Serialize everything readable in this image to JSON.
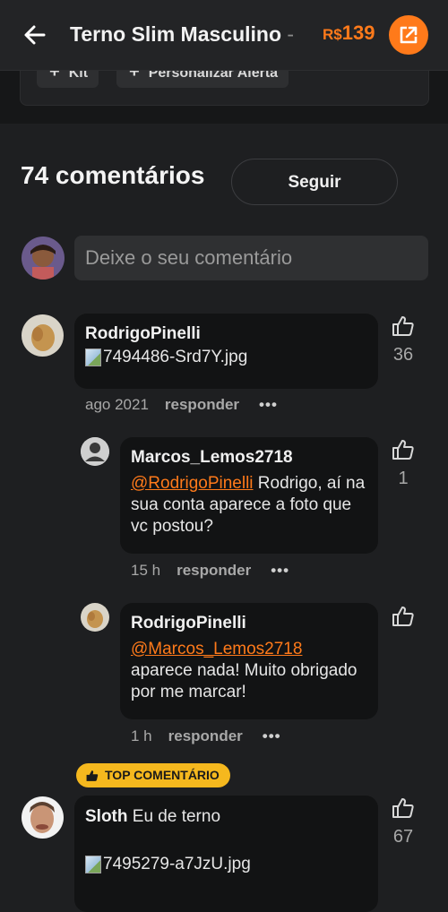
{
  "header": {
    "title": "Terno Slim Masculino",
    "title_suffix": "-",
    "price_currency": "R$",
    "price_value": "139"
  },
  "top_card": {
    "chips": [
      "Kit",
      "Personalizar Alerta"
    ]
  },
  "comments_section": {
    "title": "74 comentários",
    "follow_label": "Seguir",
    "input_placeholder": "Deixe o seu comentário"
  },
  "comments": [
    {
      "author": "RodrigoPinelli",
      "image_name": "7494486-Srd7Y.jpg",
      "date": "ago 2021",
      "reply_label": "responder",
      "more": "•••",
      "likes": "36"
    },
    {
      "author": "Marcos_Lemos2718",
      "mention": "@RodrigoPinelli",
      "text": " Rodrigo, aí na sua conta aparece a foto que vc postou?",
      "date": "15 h",
      "reply_label": "responder",
      "more": "•••",
      "likes": "1"
    },
    {
      "author": "RodrigoPinelli",
      "mention": "@Marcos_Lemos2718",
      "text": "aparece nada! Muito obrigado por me marcar!",
      "date": "1 h",
      "reply_label": "responder",
      "more": "•••",
      "likes": ""
    },
    {
      "badge": "TOP COMENTÁRIO",
      "author": "Sloth",
      "text": "Eu de terno",
      "image_name": "7495279-a7JzU.jpg",
      "likes": "67"
    }
  ],
  "colors": {
    "accent": "#ff7a1a",
    "badge": "#f5b81e",
    "background": "#1e1f21",
    "bubble": "#121314"
  }
}
